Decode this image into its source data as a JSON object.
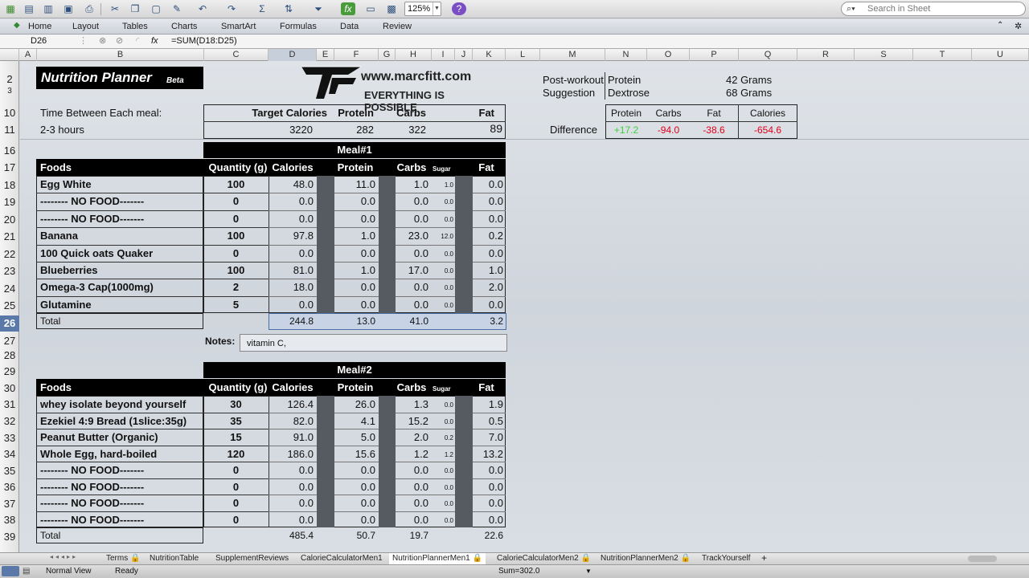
{
  "toolbar": {
    "zoom": "125%",
    "search_placeholder": "Search in Sheet"
  },
  "ribbon": {
    "tabs": [
      "Home",
      "Layout",
      "Tables",
      "Charts",
      "SmartArt",
      "Formulas",
      "Data",
      "Review"
    ]
  },
  "formula_bar": {
    "cell_ref": "D26",
    "fx": "fx",
    "formula": "=SUM(D18:D25)"
  },
  "columns": [
    "A",
    "B",
    "C",
    "D",
    "E",
    "F",
    "G",
    "H",
    "I",
    "J",
    "K",
    "L",
    "M",
    "N",
    "O",
    "P",
    "Q",
    "R",
    "S",
    "T",
    "U"
  ],
  "rows": [
    "2",
    "3",
    "10",
    "11",
    "16",
    "17",
    "18",
    "19",
    "20",
    "21",
    "22",
    "23",
    "24",
    "25",
    "26",
    "27",
    "28",
    "29",
    "30",
    "31",
    "32",
    "33",
    "34",
    "35",
    "36",
    "37",
    "38",
    "39"
  ],
  "header": {
    "title": "Nutrition Planner",
    "title_suffix": "Beta",
    "logo_url": "www.marcfitt.com",
    "logo_tagline": "EVERYTHING IS POSSIBLE",
    "time_label": "Time Between Each meal:",
    "time_value": "2-3 hours"
  },
  "targets": {
    "headers": [
      "Target Calories",
      "Protein",
      "Carbs",
      "Fat"
    ],
    "values": [
      "3220",
      "282",
      "322",
      "89"
    ]
  },
  "post_workout": {
    "label1": "Post-workout",
    "label2": "Suggestion",
    "item1": "Protein",
    "item1_value": "42 Grams",
    "item2": "Dextrose",
    "item2_value": "68 Grams"
  },
  "difference": {
    "label": "Difference",
    "headers": [
      "Protein",
      "Carbs",
      "Fat",
      "Calories"
    ],
    "values": [
      "+17.2",
      "-94.0",
      "-38.6",
      "-654.6"
    ]
  },
  "meal_headers": {
    "foods": "Foods",
    "quantity": "Quantity (g)",
    "calories": "Calories",
    "protein": "Protein",
    "carbs": "Carbs",
    "sugar": "Sugar",
    "fat": "Fat",
    "total": "Total"
  },
  "meal1": {
    "title": "Meal#1",
    "rows": [
      {
        "food": "Egg White",
        "qty": "100",
        "cal": "48.0",
        "pro": "11.0",
        "carb": "1.0",
        "sugar": "1.0",
        "fat": "0.0"
      },
      {
        "food": "-------- NO FOOD-------",
        "qty": "0",
        "cal": "0.0",
        "pro": "0.0",
        "carb": "0.0",
        "sugar": "0.0",
        "fat": "0.0"
      },
      {
        "food": "-------- NO FOOD-------",
        "qty": "0",
        "cal": "0.0",
        "pro": "0.0",
        "carb": "0.0",
        "sugar": "0.0",
        "fat": "0.0"
      },
      {
        "food": "Banana",
        "qty": "100",
        "cal": "97.8",
        "pro": "1.0",
        "carb": "23.0",
        "sugar": "12.0",
        "fat": "0.2"
      },
      {
        "food": "100 Quick oats Quaker",
        "qty": "0",
        "cal": "0.0",
        "pro": "0.0",
        "carb": "0.0",
        "sugar": "0.0",
        "fat": "0.0"
      },
      {
        "food": "Blueberries",
        "qty": "100",
        "cal": "81.0",
        "pro": "1.0",
        "carb": "17.0",
        "sugar": "0.0",
        "fat": "1.0"
      },
      {
        "food": "Omega-3 Cap(1000mg)",
        "qty": "2",
        "cal": "18.0",
        "pro": "0.0",
        "carb": "0.0",
        "sugar": "0.0",
        "fat": "2.0"
      },
      {
        "food": "Glutamine",
        "qty": "5",
        "cal": "0.0",
        "pro": "0.0",
        "carb": "0.0",
        "sugar": "0.0",
        "fat": "0.0"
      }
    ],
    "total": {
      "cal": "244.8",
      "pro": "13.0",
      "carb": "41.0",
      "fat": "3.2"
    },
    "notes_label": "Notes:",
    "notes": "vitamin C,"
  },
  "meal2": {
    "title": "Meal#2",
    "rows": [
      {
        "food": "whey isolate beyond yourself",
        "qty": "30",
        "cal": "126.4",
        "pro": "26.0",
        "carb": "1.3",
        "sugar": "0.0",
        "fat": "1.9"
      },
      {
        "food": "Ezekiel 4:9 Bread (1slice:35g)",
        "qty": "35",
        "cal": "82.0",
        "pro": "4.1",
        "carb": "15.2",
        "sugar": "0.0",
        "fat": "0.5"
      },
      {
        "food": "Peanut Butter (Organic)",
        "qty": "15",
        "cal": "91.0",
        "pro": "5.0",
        "carb": "2.0",
        "sugar": "0.2",
        "fat": "7.0"
      },
      {
        "food": "Whole Egg, hard-boiled",
        "qty": "120",
        "cal": "186.0",
        "pro": "15.6",
        "carb": "1.2",
        "sugar": "1.2",
        "fat": "13.2"
      },
      {
        "food": "-------- NO FOOD-------",
        "qty": "0",
        "cal": "0.0",
        "pro": "0.0",
        "carb": "0.0",
        "sugar": "0.0",
        "fat": "0.0"
      },
      {
        "food": "-------- NO FOOD-------",
        "qty": "0",
        "cal": "0.0",
        "pro": "0.0",
        "carb": "0.0",
        "sugar": "0.0",
        "fat": "0.0"
      },
      {
        "food": "-------- NO FOOD-------",
        "qty": "0",
        "cal": "0.0",
        "pro": "0.0",
        "carb": "0.0",
        "sugar": "0.0",
        "fat": "0.0"
      },
      {
        "food": "-------- NO FOOD-------",
        "qty": "0",
        "cal": "0.0",
        "pro": "0.0",
        "carb": "0.0",
        "sugar": "0.0",
        "fat": "0.0"
      }
    ],
    "total": {
      "cal": "485.4",
      "pro": "50.7",
      "carb": "19.7",
      "fat": "22.6"
    }
  },
  "sheet_tabs": [
    "Terms",
    "NutritionTable",
    "SupplementReviews",
    "CalorieCalculatorMen1",
    "NutritionPlannerMen1",
    "CalorieCalculatorMen2",
    "NutritionPlannerMen2",
    "TrackYourself",
    "+"
  ],
  "active_tab": "NutritionPlannerMen1",
  "status": {
    "view": "Normal View",
    "state": "Ready",
    "sum": "Sum=302.0"
  },
  "colors": {
    "positive": "#3cd23c",
    "negative": "#e0001b",
    "selection": "#5a79a8"
  }
}
